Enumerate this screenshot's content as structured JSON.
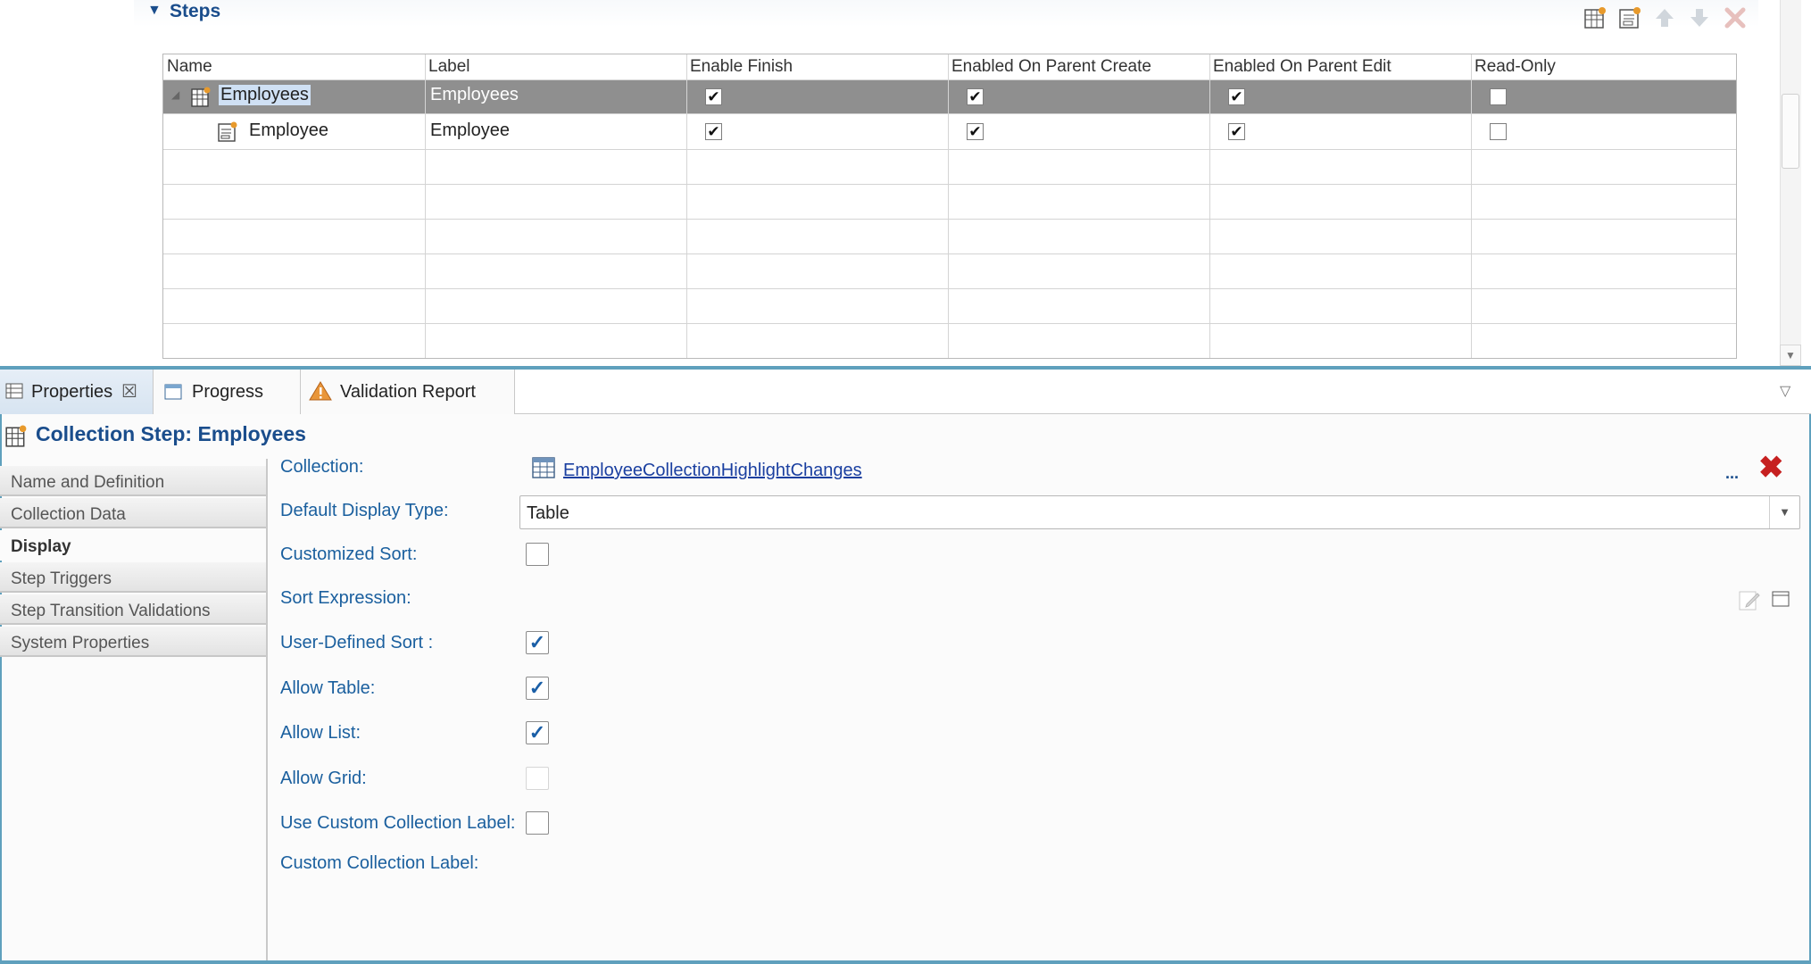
{
  "steps": {
    "title": "Steps",
    "columns": [
      "Name",
      "Label",
      "Enable Finish",
      "Enabled On Parent Create",
      "Enabled On Parent Edit",
      "Read-Only"
    ],
    "rows": [
      {
        "name": "Employees",
        "label": "Employees",
        "enable_finish": true,
        "on_create": true,
        "on_edit": true,
        "read_only": false,
        "selected": true
      },
      {
        "name": "Employee",
        "label": "Employee",
        "enable_finish": true,
        "on_create": true,
        "on_edit": true,
        "read_only": false,
        "selected": false
      }
    ],
    "toolbar_icons": [
      "add-collection-step-icon",
      "add-step-icon",
      "move-up-icon",
      "move-down-icon",
      "delete-icon"
    ]
  },
  "tabs": [
    {
      "label": "Properties",
      "icon": "properties-icon",
      "active": true
    },
    {
      "label": "Progress",
      "icon": "progress-icon",
      "active": false
    },
    {
      "label": "Validation Report",
      "icon": "warning-icon",
      "active": false
    }
  ],
  "properties": {
    "title": "Collection Step: Employees",
    "sidebar": [
      "Name and Definition",
      "Collection Data",
      "Display",
      "Step Triggers",
      "Step Transition Validations",
      "System Properties"
    ],
    "selected_sidebar": "Display",
    "collection_label": "Collection:",
    "collection_value": "EmployeeCollectionHighlightChanges",
    "collection_browse": "...",
    "default_display_label": "Default Display Type:",
    "default_display_value": "Table",
    "customized_sort_label": "Customized Sort:",
    "sort_expression_label": "Sort Expression:",
    "user_defined_sort_label": "User-Defined Sort :",
    "allow_table_label": "Allow Table:",
    "allow_list_label": "Allow List:",
    "allow_grid_label": "Allow Grid:",
    "use_custom_label_label": "Use Custom Collection Label:",
    "custom_label_label": "Custom Collection Label:",
    "checks": {
      "customized_sort": false,
      "user_defined_sort": true,
      "allow_table": true,
      "allow_list": true,
      "allow_grid": false,
      "use_custom_label": false
    }
  },
  "colors": {
    "accent": "#1a4d8c",
    "label": "#1a5f9e",
    "border": "#5fa0bd",
    "clear": "#c62020"
  }
}
